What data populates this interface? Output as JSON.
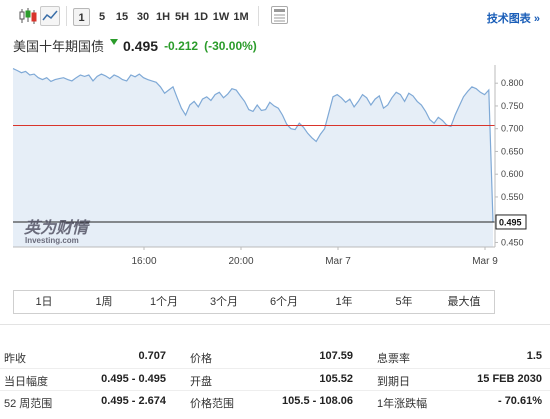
{
  "toolbar": {
    "ranges": [
      "1",
      "5",
      "15",
      "30",
      "1H",
      "5H",
      "1D",
      "1W",
      "1M"
    ],
    "active_range": "1",
    "tech_chart_link": "技术图表 »"
  },
  "title": {
    "name": "美国十年期国债",
    "price": "0.495",
    "change": "-0.212",
    "change_pct": "(-30.00%)",
    "change_color": "#2b9c2b"
  },
  "watermark": {
    "cn": "英为财情",
    "en": "Investing.com"
  },
  "range_buttons": [
    "1日",
    "1周",
    "1个月",
    "3个月",
    "6个月",
    "1年",
    "5年",
    "最大值"
  ],
  "stats": [
    [
      {
        "label": "昨收",
        "value": "0.707"
      },
      {
        "label": "价格",
        "value": "107.59"
      },
      {
        "label": "息票率",
        "value": "1.5"
      }
    ],
    [
      {
        "label": "当日幅度",
        "value": "0.495 - 0.495"
      },
      {
        "label": "开盘",
        "value": "105.52"
      },
      {
        "label": "到期日",
        "value": "15 FEB 2030"
      }
    ],
    [
      {
        "label": "52 周范围",
        "value": "0.495 - 2.674"
      },
      {
        "label": "价格范围",
        "value": "105.5 - 108.06"
      },
      {
        "label": "1年涨跌幅",
        "value": "- 70.61%"
      }
    ]
  ],
  "chart_data": {
    "type": "area",
    "x_tick_labels": [
      "16:00",
      "20:00",
      "Mar 7",
      "Mar 9"
    ],
    "y_ticks": [
      0.45,
      0.5,
      0.55,
      0.6,
      0.65,
      0.7,
      0.75,
      0.8
    ],
    "ylim": [
      0.44,
      0.84
    ],
    "reference_line": 0.707,
    "last_value_label": "0.495",
    "line_color": "#7fa9d6",
    "fill_color": "#e6eef7",
    "reference_color": "#d9342b",
    "series": [
      {
        "values": [
          0.832,
          0.828,
          0.823,
          0.826,
          0.818,
          0.82,
          0.812,
          0.808,
          0.812,
          0.804,
          0.808,
          0.81,
          0.812,
          0.808,
          0.805,
          0.812,
          0.818,
          0.815,
          0.818,
          0.805,
          0.815,
          0.82,
          0.816,
          0.81,
          0.818,
          0.814,
          0.808,
          0.805,
          0.818,
          0.814,
          0.82,
          0.812,
          0.808,
          0.805,
          0.802,
          0.792,
          0.778,
          0.785,
          0.792,
          0.768,
          0.745,
          0.73,
          0.752,
          0.76,
          0.748,
          0.765,
          0.77,
          0.762,
          0.775,
          0.78,
          0.768,
          0.776,
          0.788,
          0.785,
          0.772,
          0.76,
          0.742,
          0.738,
          0.752,
          0.74,
          0.742,
          0.758,
          0.75,
          0.745,
          0.73,
          0.71,
          0.7,
          0.698,
          0.712,
          0.703,
          0.69,
          0.68,
          0.672,
          0.688,
          0.7,
          0.735,
          0.77,
          0.775,
          0.768,
          0.758,
          0.765,
          0.748,
          0.76,
          0.775,
          0.768,
          0.752,
          0.765,
          0.772,
          0.745,
          0.752,
          0.768,
          0.78,
          0.775,
          0.76,
          0.778,
          0.772,
          0.76,
          0.752,
          0.738,
          0.72,
          0.712,
          0.725,
          0.718,
          0.708,
          0.705,
          0.73,
          0.75,
          0.77,
          0.782,
          0.792,
          0.788,
          0.78,
          0.775,
          0.785,
          0.495
        ]
      }
    ]
  }
}
